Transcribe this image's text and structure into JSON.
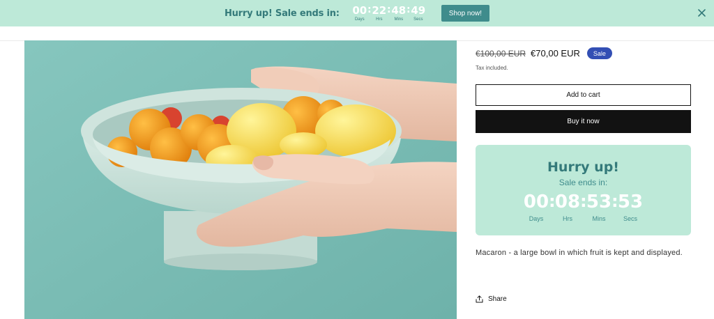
{
  "announcement": {
    "title": "Hurry up! Sale ends in:",
    "timer": [
      {
        "value": "00",
        "label": "Days"
      },
      {
        "value": "22",
        "label": "Hrs"
      },
      {
        "value": "48",
        "label": "Mins"
      },
      {
        "value": "49",
        "label": "Secs"
      }
    ],
    "button_label": "Shop now!",
    "close_icon": "close-icon"
  },
  "product": {
    "price_old": "€100,00 EUR",
    "price_new": "€70,00 EUR",
    "badge": "Sale",
    "tax_note": "Tax included.",
    "add_to_cart": "Add to cart",
    "buy_now": "Buy it now",
    "countdown": {
      "title": "Hurry up!",
      "subtitle": "Sale ends in:",
      "timer": [
        {
          "value": "00",
          "label": "Days"
        },
        {
          "value": "08",
          "label": "Hrs"
        },
        {
          "value": "53",
          "label": "Mins"
        },
        {
          "value": "53",
          "label": "Secs"
        }
      ]
    },
    "description": "Macaron - a large bowl in which fruit is kept and displayed.",
    "share_label": "Share",
    "share_icon": "share-icon"
  },
  "colors": {
    "announcement_bg": "#bde9d8",
    "accent_teal": "#347a7a",
    "button_teal": "#3f8c8c",
    "sale_badge": "#334fb4",
    "buy_button": "#121212"
  }
}
